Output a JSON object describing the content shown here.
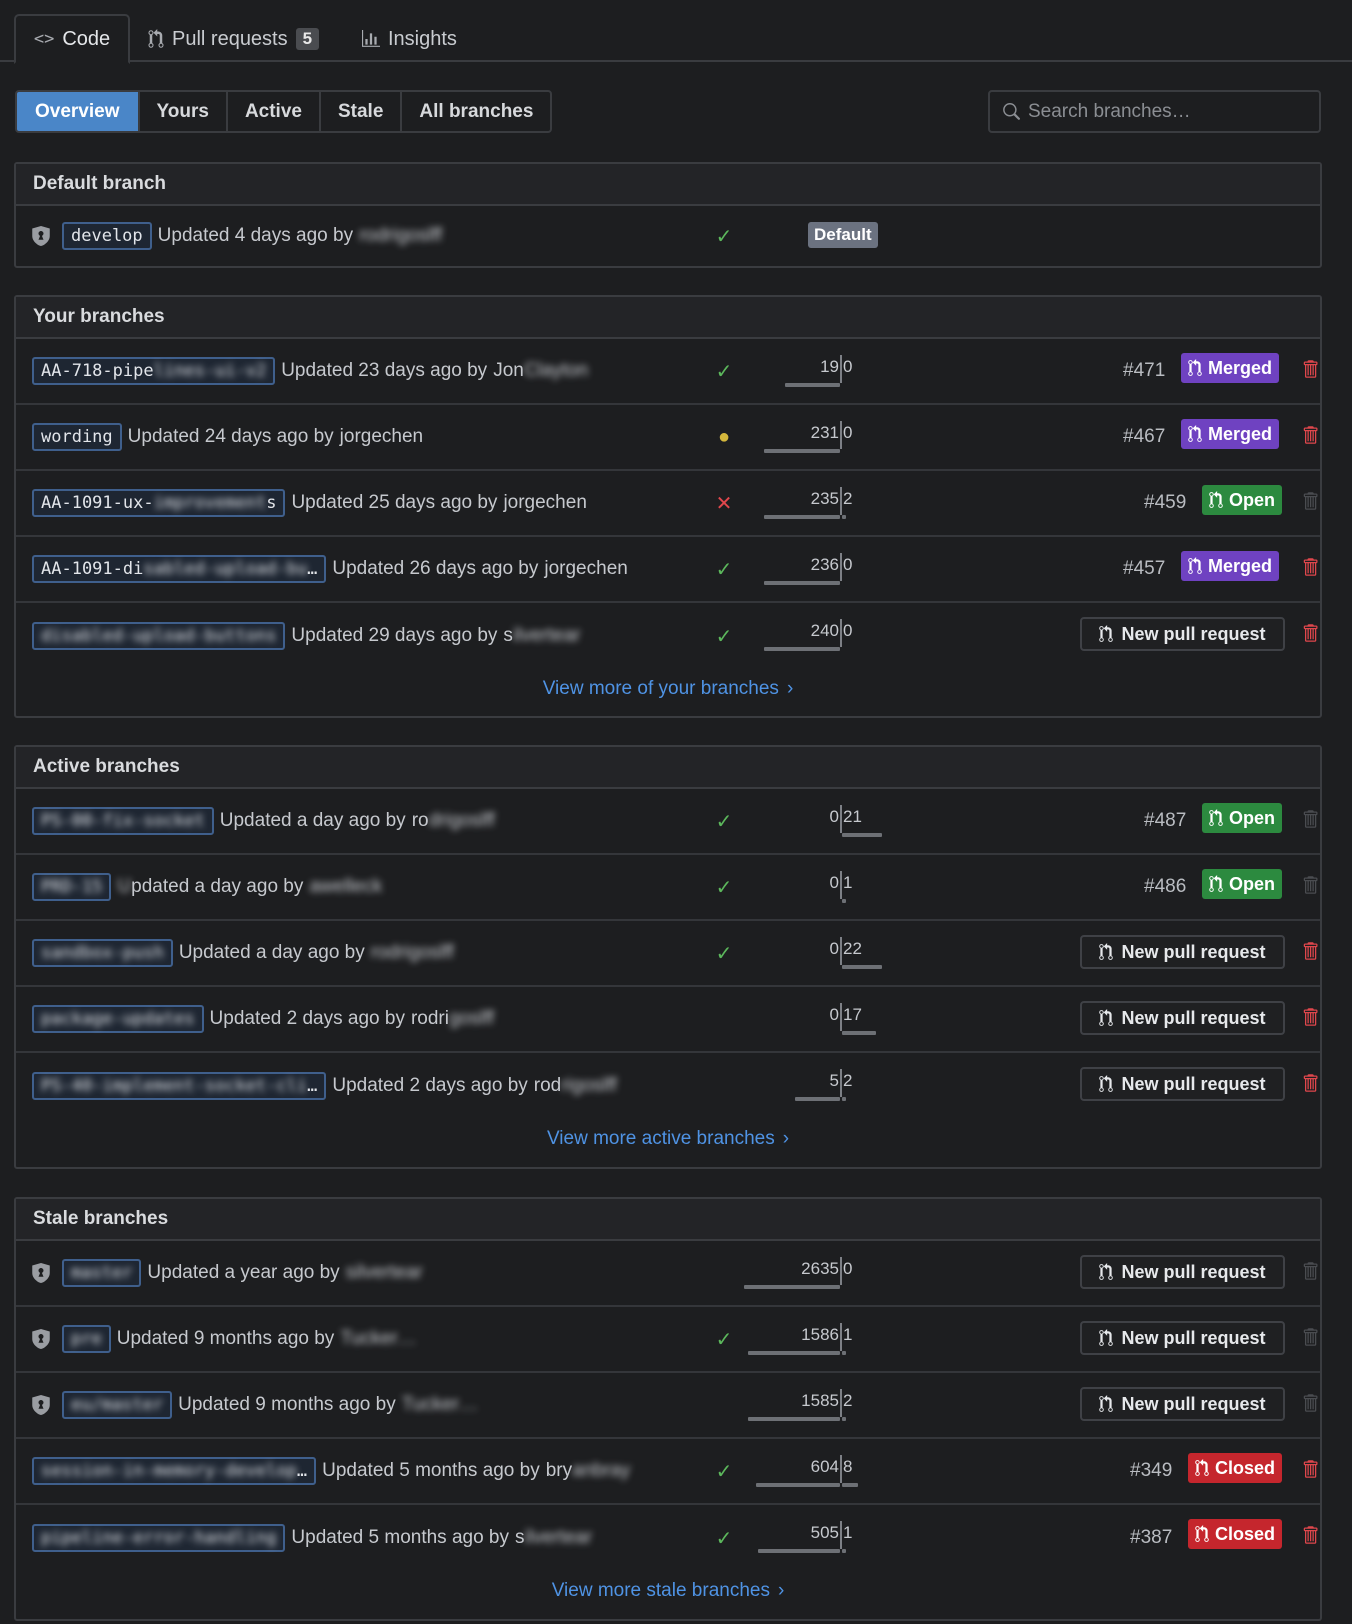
{
  "repo_tabs": {
    "code": "Code",
    "pull_requests": "Pull requests",
    "pull_requests_count": "5",
    "insights": "Insights"
  },
  "subnav": [
    "Overview",
    "Yours",
    "Active",
    "Stale",
    "All branches"
  ],
  "search": {
    "placeholder": "Search branches…"
  },
  "default_section": {
    "title": "Default branch",
    "branch": {
      "name": "develop",
      "meta": "Updated 4 days ago by",
      "author": "rodrigoslff",
      "badge": "Default"
    }
  },
  "your_section": {
    "title": "Your branches",
    "view_more": "View more of your branches",
    "rows": [
      {
        "name": "AA-718-pipe",
        "name_hidden": "lines-ui-v2",
        "meta": "Updated 23 days ago by",
        "author": "Jon",
        "author_hidden": "Clayton",
        "status": "✓",
        "behind": "19",
        "ahead": "0",
        "pr": "#471",
        "state": "Merged"
      },
      {
        "name": "wording",
        "name_hidden": "",
        "meta": "Updated 24 days ago by",
        "author": "jorgechen",
        "author_hidden": "",
        "status": "●",
        "behind": "231",
        "ahead": "0",
        "pr": "#467",
        "state": "Merged"
      },
      {
        "name": "AA-1091-ux-",
        "name_hidden": "improvement",
        "name_tail": "s",
        "meta": "Updated 25 days ago by",
        "author": "jorgechen",
        "author_hidden": "",
        "status": "✕",
        "behind": "235",
        "ahead": "2",
        "pr": "#459",
        "state": "Open"
      },
      {
        "name": "AA-1091-di",
        "name_hidden": "sabled-upload-bu",
        "name_tail": "…",
        "meta": "Updated 26 days ago by",
        "author": "jorgechen",
        "author_hidden": "",
        "status": "✓",
        "behind": "236",
        "ahead": "0",
        "pr": "#457",
        "state": "Merged"
      },
      {
        "name": "",
        "name_hidden": "disabled-upload-buttons",
        "meta": "Updated 29 days ago by",
        "author": "s",
        "author_hidden": "ilvertear",
        "status": "✓",
        "behind": "240",
        "ahead": "0",
        "new_pr": "New pull request"
      }
    ]
  },
  "active_section": {
    "title": "Active branches",
    "view_more": "View more active branches",
    "rows": [
      {
        "name_hidden": "PS-00-fix-socket",
        "meta": "Updated a day ago by",
        "author": "ro",
        "author_hidden": "drigoslff",
        "status": "✓",
        "behind": "0",
        "ahead": "21",
        "pr": "#487",
        "state": "Open"
      },
      {
        "name_hidden": "PRD-15",
        "meta": "pdated a day ago by",
        "meta_hidden": "U",
        "author": "",
        "author_hidden": "awelleck",
        "status": "✓",
        "behind": "0",
        "ahead": "1",
        "pr": "#486",
        "state": "Open"
      },
      {
        "name_hidden": "sandbox-push",
        "meta": "Updated a day ago by",
        "author": "",
        "author_hidden": "rodrigoslff",
        "status": "✓",
        "behind": "0",
        "ahead": "22",
        "new_pr": "New pull request"
      },
      {
        "name_hidden": "package-updates",
        "meta": "Updated 2 days ago by",
        "author": "rodri",
        "author_hidden": "goslff",
        "status": "",
        "behind": "0",
        "ahead": "17",
        "new_pr": "New pull request"
      },
      {
        "name_hidden": "PS-40-implement-socket-cli",
        "name_tail": "…",
        "meta": "Updated 2 days ago by",
        "author": "rod",
        "author_hidden": "rigoslff",
        "status": "",
        "behind": "5",
        "ahead": "2",
        "new_pr": "New pull request"
      }
    ]
  },
  "stale_section": {
    "title": "Stale branches",
    "view_more": "View more stale branches",
    "rows": [
      {
        "name_hidden": "master",
        "meta": "Updated a year ago by",
        "author": "",
        "author_hidden": "silvertear",
        "status": "",
        "behind": "2635",
        "ahead": "0",
        "new_pr": "New pull request",
        "protected": true
      },
      {
        "name_hidden": "pre",
        "meta": "Updated 9 months ago by",
        "author": "",
        "author_hidden": "Tucker…",
        "status": "✓",
        "behind": "1586",
        "ahead": "1",
        "new_pr": "New pull request",
        "protected": true
      },
      {
        "name_hidden": "eu/master",
        "meta": "Updated 9 months ago by",
        "author": "",
        "author_hidden": "Tucker…",
        "status": "",
        "behind": "1585",
        "ahead": "2",
        "new_pr": "New pull request",
        "protected": true
      },
      {
        "name_hidden": "session-in-memory-develop",
        "name_tail": "…",
        "meta": "Updated 5 months ago by",
        "author": "bry",
        "author_hidden": "anbray",
        "status": "✓",
        "behind": "604",
        "ahead": "8",
        "pr": "#349",
        "state": "Closed"
      },
      {
        "name_hidden": "pipeline-error-handling",
        "meta": "Updated 5 months ago by",
        "author": "s",
        "author_hidden": "ilvertear",
        "status": "✓",
        "behind": "505",
        "ahead": "1",
        "pr": "#387",
        "state": "Closed"
      }
    ]
  },
  "colors": {
    "accent": "#4a86c8",
    "link": "#4f93e4",
    "merged": "#6f42c1",
    "open": "#2c8a3f",
    "closed": "#c5262d",
    "success": "#5cb85c",
    "failure": "#e0474c",
    "pending": "#d4b73c",
    "trash_active": "#e0474c",
    "trash_disabled": "#4a4c50"
  },
  "icons": {
    "code_tab": "code-icon",
    "pr_tab": "git-pull-request-icon",
    "insights_tab": "graph-icon",
    "search": "search-icon",
    "protected": "shield-icon",
    "delete": "trash-icon",
    "chevron": "chevron-right-icon"
  }
}
